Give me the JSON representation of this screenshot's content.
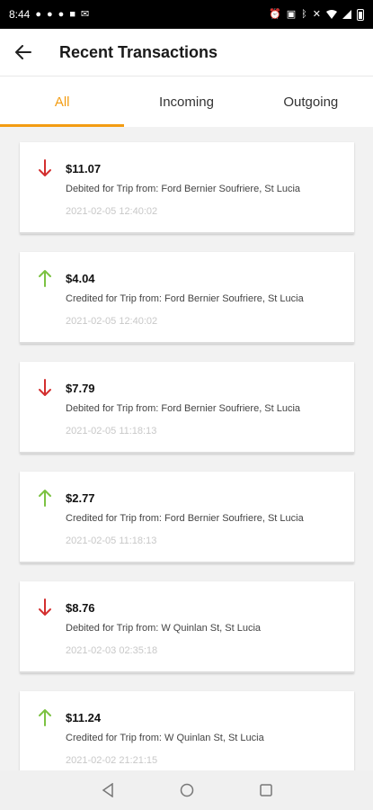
{
  "status_bar": {
    "time": "8:44",
    "left_icons": [
      "messenger-icon",
      "facebook-icon",
      "facebook-icon",
      "app-icon",
      "mail-icon"
    ],
    "right_icons": [
      "alarm-icon",
      "nfc-icon",
      "bluetooth-icon",
      "mute-icon",
      "wifi-icon",
      "signal-icon",
      "battery-icon"
    ]
  },
  "header": {
    "title": "Recent Transactions",
    "back_icon": "arrow-left-icon"
  },
  "tabs": [
    {
      "label": "All",
      "active": true
    },
    {
      "label": "Incoming",
      "active": false
    },
    {
      "label": "Outgoing",
      "active": false
    }
  ],
  "colors": {
    "accent": "#f39c12",
    "debit": "#d32f2f",
    "credit": "#7cc242"
  },
  "transactions": [
    {
      "amount": "$11.07",
      "description": "Debited for Trip from: Ford Bernier Soufriere, St Lucia",
      "date": "2021-02-05 12:40:02",
      "direction": "debit"
    },
    {
      "amount": "$4.04",
      "description": "Credited for Trip from: Ford Bernier Soufriere, St Lucia",
      "date": "2021-02-05 12:40:02",
      "direction": "credit"
    },
    {
      "amount": "$7.79",
      "description": "Debited for Trip from: Ford Bernier Soufriere, St Lucia",
      "date": "2021-02-05 11:18:13",
      "direction": "debit"
    },
    {
      "amount": "$2.77",
      "description": "Credited for Trip from: Ford Bernier Soufriere, St Lucia",
      "date": "2021-02-05 11:18:13",
      "direction": "credit"
    },
    {
      "amount": "$8.76",
      "description": "Debited for Trip from: W Quinlan St, St Lucia",
      "date": "2021-02-03 02:35:18",
      "direction": "debit"
    },
    {
      "amount": "$11.24",
      "description": "Credited for Trip from: W Quinlan St, St Lucia",
      "date": "2021-02-02 21:21:15",
      "direction": "credit"
    }
  ],
  "nav_bar": {
    "buttons": [
      "back-triangle-icon",
      "home-circle-icon",
      "recents-square-icon"
    ]
  }
}
